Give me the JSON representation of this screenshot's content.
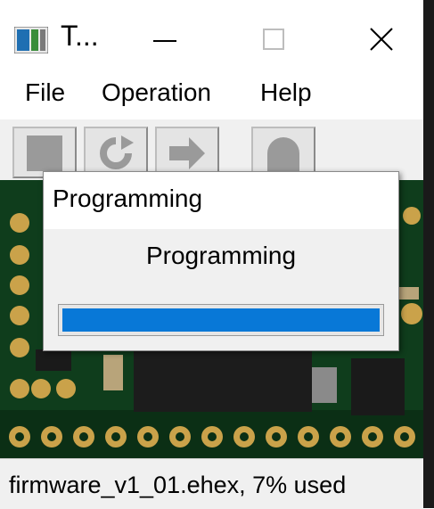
{
  "window": {
    "title": "T..."
  },
  "menu": {
    "items": [
      "File",
      "Operation",
      "Help"
    ]
  },
  "toolbar": {
    "buttons": [
      "stop-icon",
      "reload-icon",
      "program-icon",
      "reboot-icon"
    ]
  },
  "dialog": {
    "title": "Programming",
    "message": "Programming",
    "progress": 1.0,
    "progress_color": "#0878d7"
  },
  "status": {
    "text": "firmware_v1_01.ehex, 7% used"
  }
}
